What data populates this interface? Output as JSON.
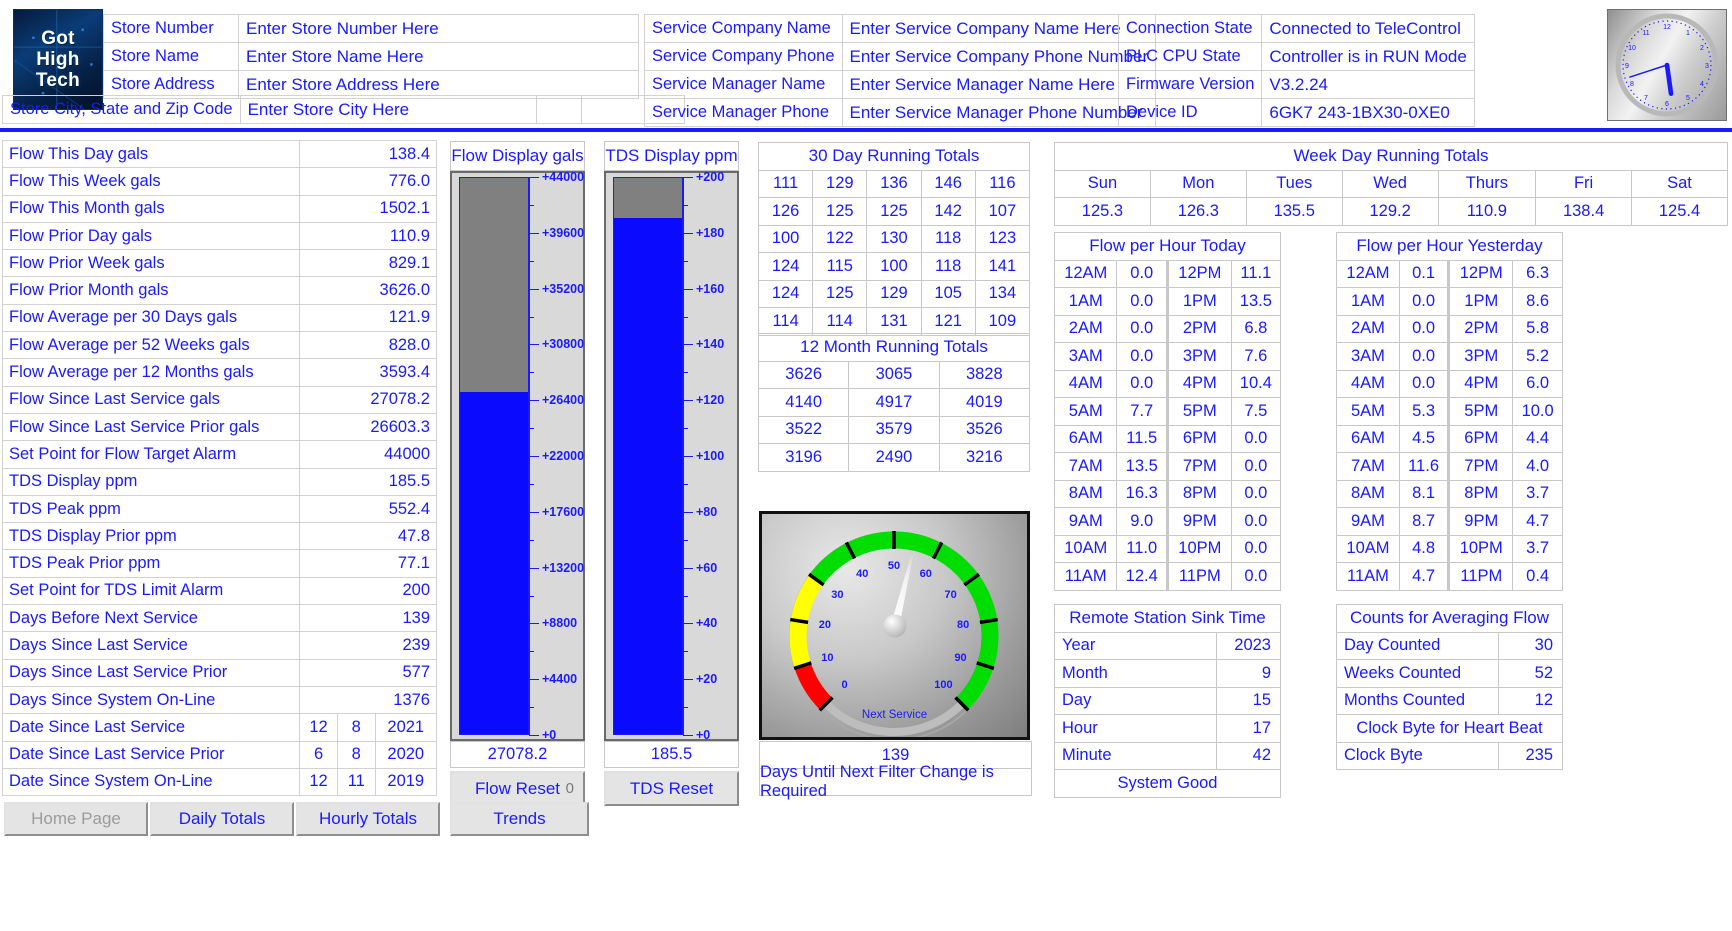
{
  "header": {
    "logo": {
      "line1": "Got",
      "line2": "High",
      "line3": "Tech"
    },
    "store": [
      {
        "label": "Store Number",
        "value": "Enter Store Number Here"
      },
      {
        "label": "Store Name",
        "value": "Enter Store Name Here"
      },
      {
        "label": "Store Address",
        "value": "Enter Store Address Here"
      },
      {
        "label": "Store City, State and Zip Code",
        "value": "Enter Store City Here"
      }
    ],
    "service": [
      {
        "label": "Service Company Name",
        "value": "Enter Service Company Name Here"
      },
      {
        "label": "Service Company Phone",
        "value": "Enter Service Company Phone Number"
      },
      {
        "label": "Service Manager Name",
        "value": "Enter Service Manager Name Here"
      },
      {
        "label": "Service Manager Phone",
        "value": "Enter Service Manager Phone Number"
      }
    ],
    "device": [
      {
        "label": "Connection State",
        "value": "Connected to TeleControl"
      },
      {
        "label": "PLC CPU State",
        "value": "Controller is in RUN Mode"
      },
      {
        "label": "Firmware Version",
        "value": "V3.2.24"
      },
      {
        "label": "Device ID",
        "value": "6GK7 243-1BX30-0XE0"
      }
    ],
    "clock": {
      "name": "analog-clock",
      "hour_deg": 172,
      "minute_deg": 252
    }
  },
  "params": [
    {
      "label": "Flow This Day gals",
      "value": "138.4"
    },
    {
      "label": "Flow This Week gals",
      "value": "776.0"
    },
    {
      "label": "Flow This Month gals",
      "value": "1502.1"
    },
    {
      "label": "Flow Prior Day gals",
      "value": "110.9"
    },
    {
      "label": "Flow Prior Week gals",
      "value": "829.1"
    },
    {
      "label": "Flow Prior Month gals",
      "value": "3626.0"
    },
    {
      "label": "Flow Average per 30 Days gals",
      "value": "121.9"
    },
    {
      "label": "Flow Average per 52 Weeks gals",
      "value": "828.0"
    },
    {
      "label": "Flow Average per 12 Months gals",
      "value": "3593.4"
    },
    {
      "label": "Flow Since Last Service gals",
      "value": "27078.2"
    },
    {
      "label": "Flow Since Last Service Prior gals",
      "value": "26603.3"
    },
    {
      "label": "Set Point for Flow Target Alarm",
      "value": "44000"
    },
    {
      "label": "TDS Display ppm",
      "value": "185.5"
    },
    {
      "label": "TDS Peak ppm",
      "value": "552.4"
    },
    {
      "label": "TDS Display Prior ppm",
      "value": "47.8"
    },
    {
      "label": "TDS Peak Prior ppm",
      "value": "77.1"
    },
    {
      "label": "Set Point for TDS Limit Alarm",
      "value": "200"
    },
    {
      "label": "Days Before Next Service",
      "value": "139"
    },
    {
      "label": "Days Since Last Service",
      "value": "239"
    },
    {
      "label": "Days Since Last Service Prior",
      "value": "577"
    },
    {
      "label": "Days Since System On-Line",
      "value": "1376"
    }
  ],
  "date_rows": [
    {
      "label": "Date Since Last Service",
      "d": "12",
      "m": "8",
      "y": "2021"
    },
    {
      "label": "Date Since Last Service Prior",
      "d": "6",
      "m": "8",
      "y": "2020"
    },
    {
      "label": "Date Since System On-Line",
      "d": "12",
      "m": "11",
      "y": "2019"
    }
  ],
  "flow_bar": {
    "title": "Flow Display gals",
    "value": "27078.2",
    "value_num": 27078.2,
    "min": 0,
    "max": 44000,
    "ticks": [
      "+44000",
      "+39600",
      "+35200",
      "+30800",
      "+26400",
      "+22000",
      "+17600",
      "+13200",
      "+8800",
      "+4400",
      "+0"
    ],
    "reset_label": "Flow Reset",
    "reset_count": "0"
  },
  "tds_bar": {
    "title": "TDS Display ppm",
    "value": "185.5",
    "value_num": 185.5,
    "min": 0,
    "max": 200,
    "ticks": [
      "+200",
      "+180",
      "+160",
      "+140",
      "+120",
      "+100",
      "+80",
      "+60",
      "+40",
      "+20",
      "+0"
    ],
    "reset_label": "TDS Reset"
  },
  "running_30day": {
    "title": "30 Day Running Totals",
    "rows": [
      [
        "111",
        "129",
        "136",
        "146",
        "116"
      ],
      [
        "126",
        "125",
        "125",
        "142",
        "107"
      ],
      [
        "100",
        "122",
        "130",
        "118",
        "123"
      ],
      [
        "124",
        "115",
        "100",
        "118",
        "141"
      ],
      [
        "124",
        "125",
        "129",
        "105",
        "134"
      ],
      [
        "114",
        "114",
        "131",
        "121",
        "109"
      ]
    ]
  },
  "running_12month": {
    "title": "12 Month Running Totals",
    "rows": [
      [
        "3626",
        "3065",
        "3828"
      ],
      [
        "4140",
        "4917",
        "4019"
      ],
      [
        "3522",
        "3579",
        "3526"
      ],
      [
        "3196",
        "2490",
        "3216"
      ]
    ]
  },
  "service_gauge": {
    "value": "139",
    "caption": "Next Service",
    "footer": "Days Until Next Filter Change is Required",
    "scale_labels": [
      "0",
      "10",
      "20",
      "30",
      "40",
      "50",
      "60",
      "70",
      "80",
      "90",
      "100"
    ],
    "needle_value": 55,
    "colors": {
      "low": "#ff0000",
      "mid": "#ffff00",
      "high": "#00dd00"
    }
  },
  "weekday_totals": {
    "title": "Week Day Running Totals",
    "days": [
      "Sun",
      "Mon",
      "Tues",
      "Wed",
      "Thurs",
      "Fri",
      "Sat"
    ],
    "values": [
      "125.3",
      "126.3",
      "135.5",
      "129.2",
      "110.9",
      "138.4",
      "125.4"
    ]
  },
  "flow_today": {
    "title": "Flow per Hour Today",
    "am": [
      [
        "12AM",
        "0.0"
      ],
      [
        "1AM",
        "0.0"
      ],
      [
        "2AM",
        "0.0"
      ],
      [
        "3AM",
        "0.0"
      ],
      [
        "4AM",
        "0.0"
      ],
      [
        "5AM",
        "7.7"
      ],
      [
        "6AM",
        "11.5"
      ],
      [
        "7AM",
        "13.5"
      ],
      [
        "8AM",
        "16.3"
      ],
      [
        "9AM",
        "9.0"
      ],
      [
        "10AM",
        "11.0"
      ],
      [
        "11AM",
        "12.4"
      ]
    ],
    "pm": [
      [
        "12PM",
        "11.1"
      ],
      [
        "1PM",
        "13.5"
      ],
      [
        "2PM",
        "6.8"
      ],
      [
        "3PM",
        "7.6"
      ],
      [
        "4PM",
        "10.4"
      ],
      [
        "5PM",
        "7.5"
      ],
      [
        "6PM",
        "0.0"
      ],
      [
        "7PM",
        "0.0"
      ],
      [
        "8PM",
        "0.0"
      ],
      [
        "9PM",
        "0.0"
      ],
      [
        "10PM",
        "0.0"
      ],
      [
        "11PM",
        "0.0"
      ]
    ]
  },
  "flow_yesterday": {
    "title": "Flow per Hour Yesterday",
    "am": [
      [
        "12AM",
        "0.1"
      ],
      [
        "1AM",
        "0.0"
      ],
      [
        "2AM",
        "0.0"
      ],
      [
        "3AM",
        "0.0"
      ],
      [
        "4AM",
        "0.0"
      ],
      [
        "5AM",
        "5.3"
      ],
      [
        "6AM",
        "4.5"
      ],
      [
        "7AM",
        "11.6"
      ],
      [
        "8AM",
        "8.1"
      ],
      [
        "9AM",
        "8.7"
      ],
      [
        "10AM",
        "4.8"
      ],
      [
        "11AM",
        "4.7"
      ]
    ],
    "pm": [
      [
        "12PM",
        "6.3"
      ],
      [
        "1PM",
        "8.6"
      ],
      [
        "2PM",
        "5.8"
      ],
      [
        "3PM",
        "5.2"
      ],
      [
        "4PM",
        "6.0"
      ],
      [
        "5PM",
        "10.0"
      ],
      [
        "6PM",
        "4.4"
      ],
      [
        "7PM",
        "4.0"
      ],
      [
        "8PM",
        "3.7"
      ],
      [
        "9PM",
        "4.7"
      ],
      [
        "10PM",
        "3.7"
      ],
      [
        "11PM",
        "0.4"
      ]
    ]
  },
  "sink_time": {
    "title": "Remote Station Sink Time",
    "rows": [
      {
        "label": "Year",
        "value": "2023"
      },
      {
        "label": "Month",
        "value": "9"
      },
      {
        "label": "Day",
        "value": "15"
      },
      {
        "label": "Hour",
        "value": "17"
      },
      {
        "label": "Minute",
        "value": "42"
      }
    ],
    "status": "System Good"
  },
  "averaging": {
    "title": "Counts for Averaging Flow",
    "rows": [
      {
        "label": "Day Counted",
        "value": "30"
      },
      {
        "label": "Weeks Counted",
        "value": "52"
      },
      {
        "label": "Months Counted",
        "value": "12"
      }
    ],
    "heartbeat_title": "Clock Byte for Heart Beat",
    "heartbeat": {
      "label": "Clock Byte",
      "value": "235"
    }
  },
  "nav": {
    "home": "Home Page",
    "daily": "Daily Totals",
    "hourly": "Hourly Totals",
    "trends": "Trends"
  }
}
